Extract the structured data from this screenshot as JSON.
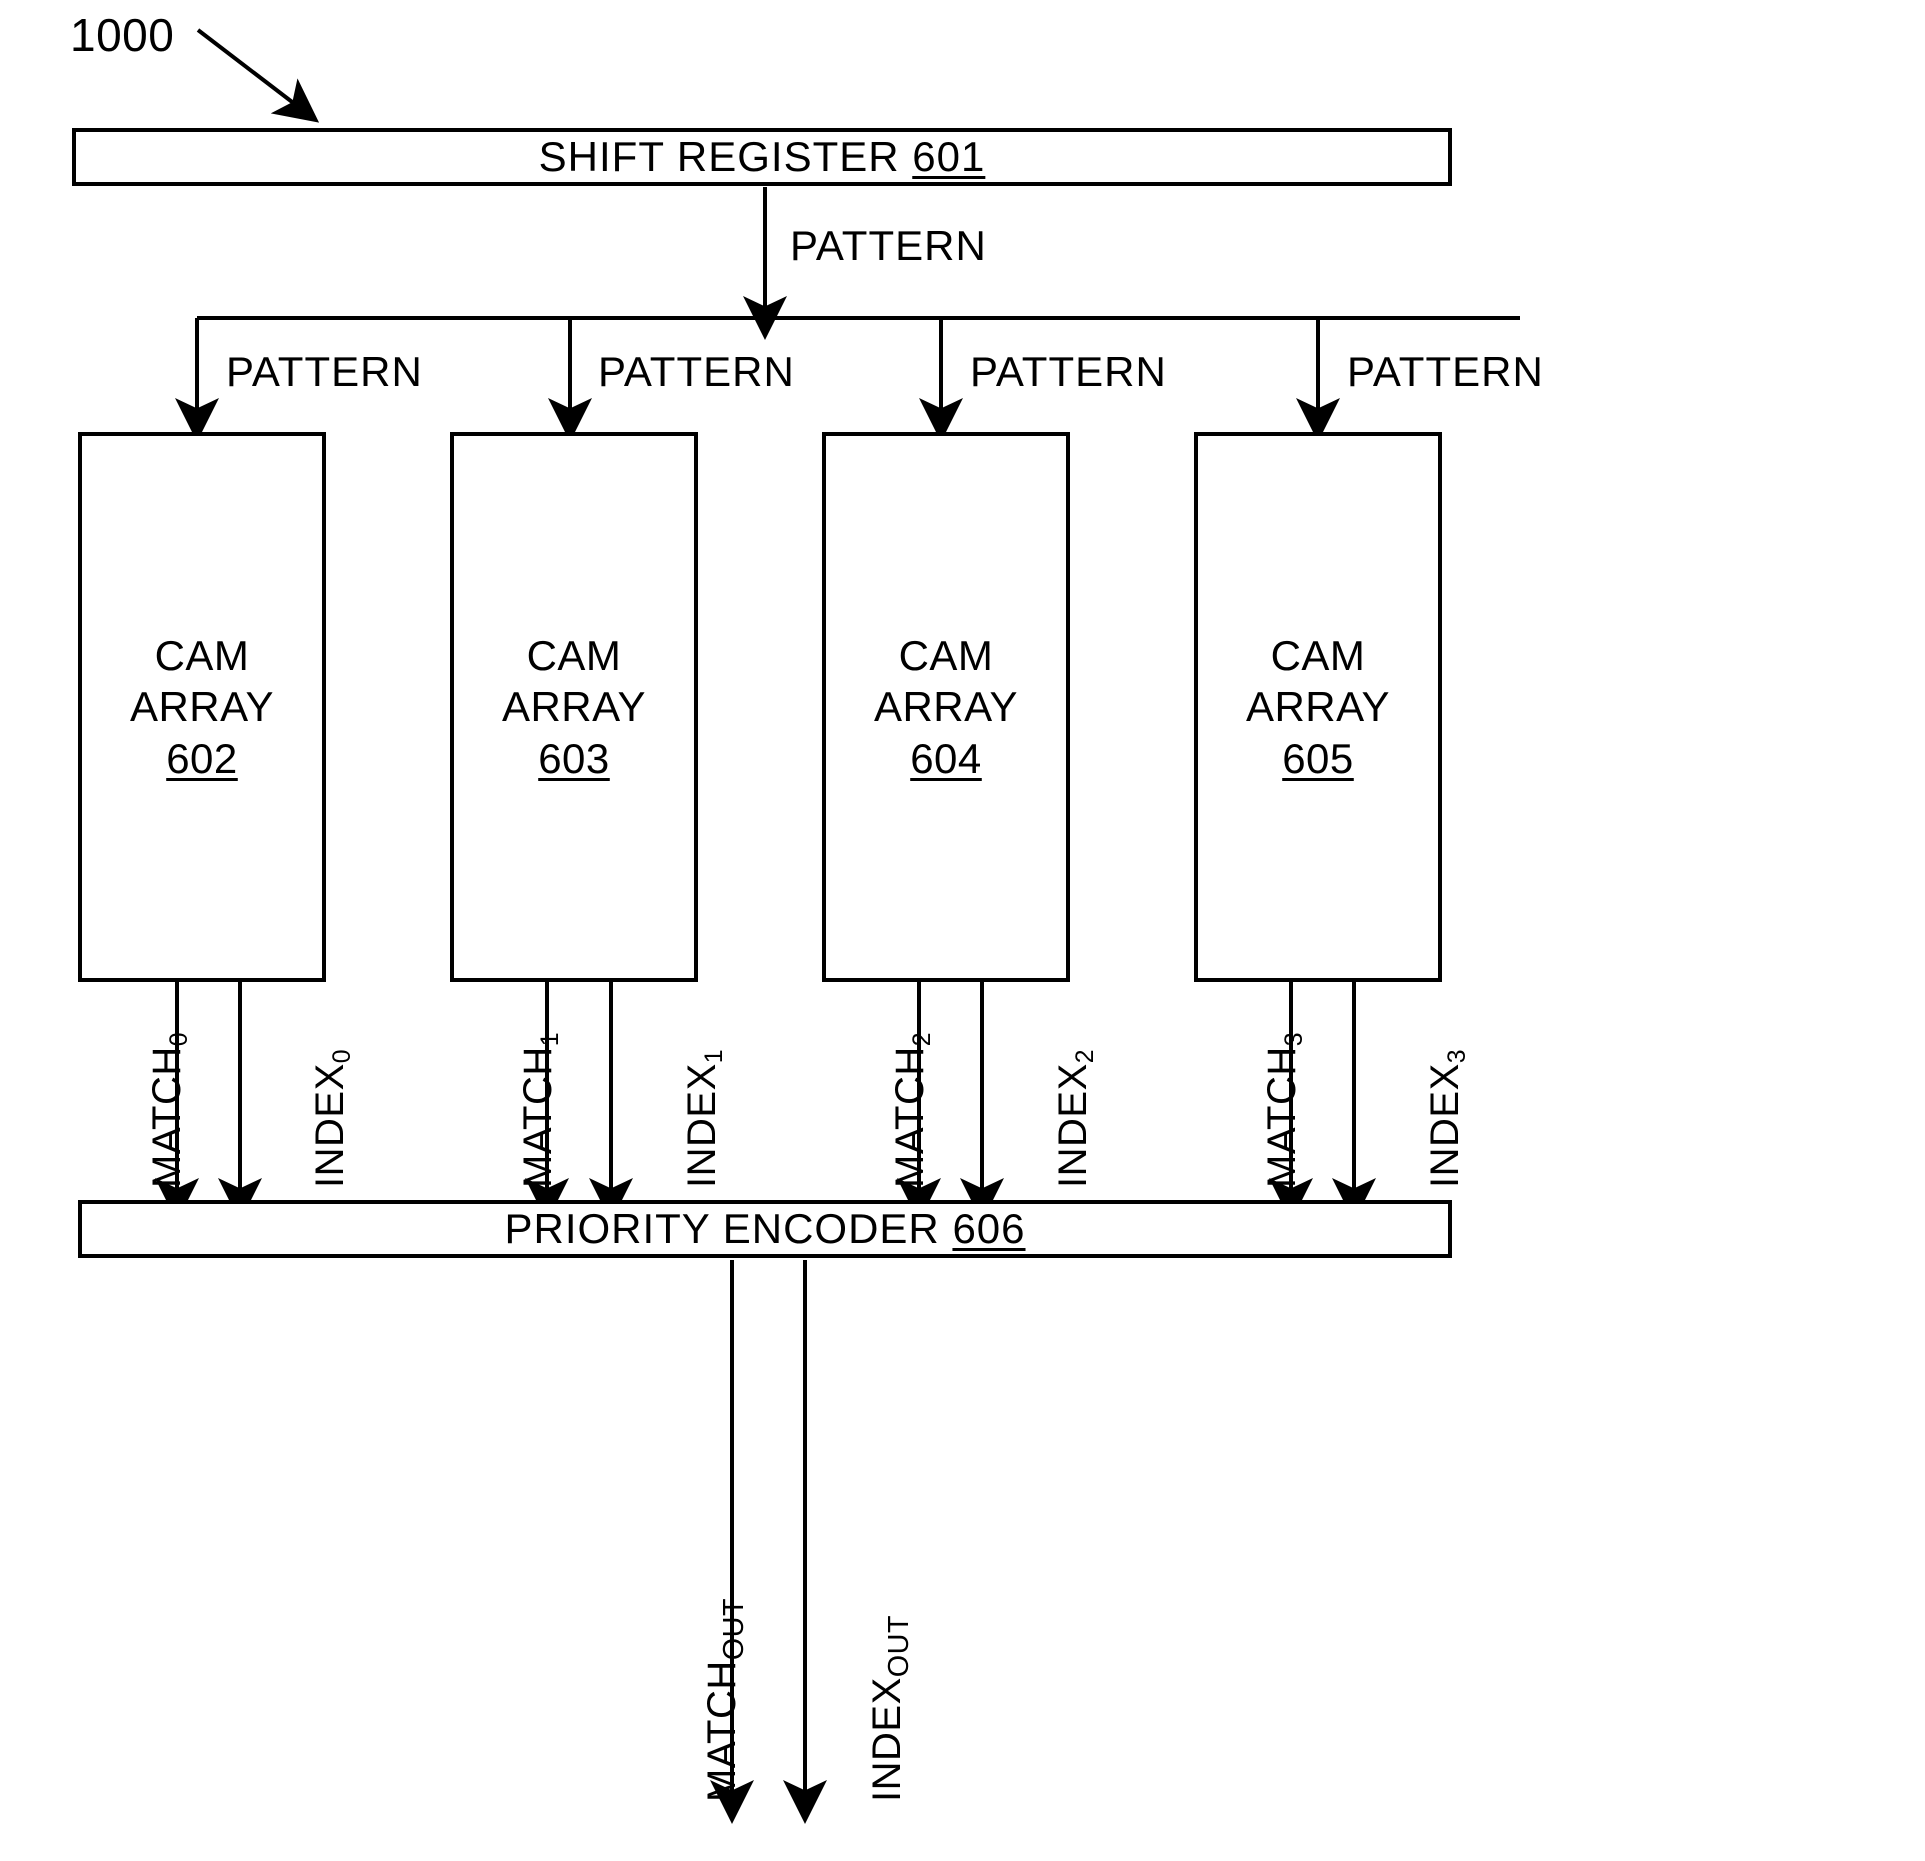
{
  "figure": {
    "number": "1000"
  },
  "shift_register": {
    "label": "SHIFT REGISTER",
    "ref": "601"
  },
  "priority_encoder": {
    "label": "PRIORITY ENCODER",
    "ref": "606"
  },
  "pattern_bus": {
    "main_label": "PATTERN",
    "branch_labels": [
      "PATTERN",
      "PATTERN",
      "PATTERN",
      "PATTERN"
    ]
  },
  "cam_arrays": [
    {
      "line1": "CAM",
      "line2": "ARRAY",
      "ref": "602",
      "match": "MATCH",
      "match_sub": "0",
      "index": "INDEX",
      "index_sub": "0"
    },
    {
      "line1": "CAM",
      "line2": "ARRAY",
      "ref": "603",
      "match": "MATCH",
      "match_sub": "1",
      "index": "INDEX",
      "index_sub": "1"
    },
    {
      "line1": "CAM",
      "line2": "ARRAY",
      "ref": "604",
      "match": "MATCH",
      "match_sub": "2",
      "index": "INDEX",
      "index_sub": "2"
    },
    {
      "line1": "CAM",
      "line2": "ARRAY",
      "ref": "605",
      "match": "MATCH",
      "match_sub": "3",
      "index": "INDEX",
      "index_sub": "3"
    }
  ],
  "outputs": [
    {
      "name": "MATCH",
      "sub": "OUT"
    },
    {
      "name": "INDEX",
      "sub": "OUT"
    }
  ],
  "colors": {
    "ink": "#000000",
    "paper": "#ffffff"
  }
}
